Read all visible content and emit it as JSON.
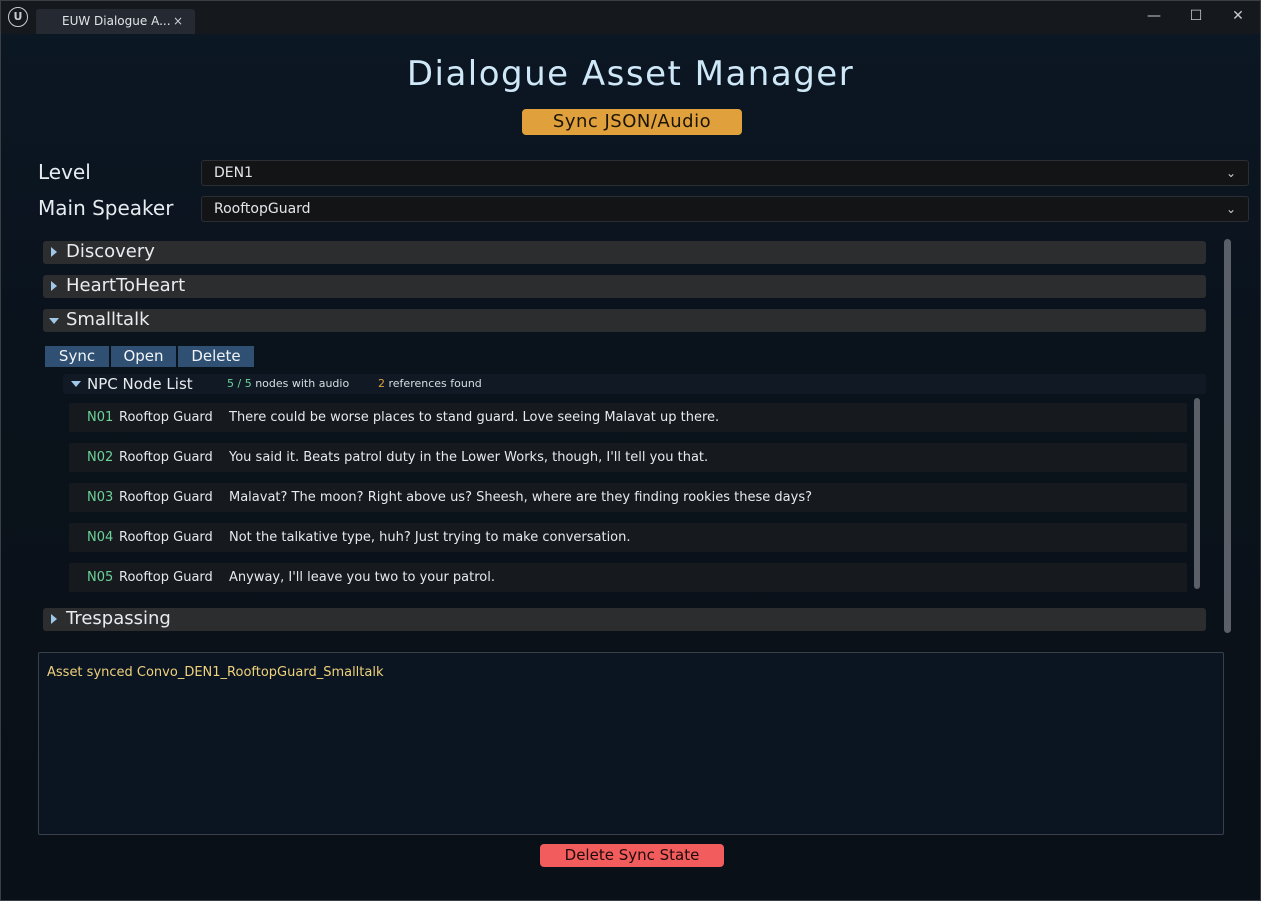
{
  "window": {
    "tab_title": "EUW Dialogue A...",
    "tab_close": "×",
    "logo": "U",
    "controls": {
      "minimize": "—",
      "maximize": "☐",
      "close": "✕"
    }
  },
  "header": {
    "title": "Dialogue Asset Manager",
    "sync_button": "Sync JSON/Audio"
  },
  "filters": {
    "level_label": "Level",
    "level_value": "DEN1",
    "speaker_label": "Main Speaker",
    "speaker_value": "RooftopGuard"
  },
  "sections": [
    {
      "label": "Discovery",
      "expanded": false
    },
    {
      "label": "HeartToHeart",
      "expanded": false
    },
    {
      "label": "Smalltalk",
      "expanded": true
    },
    {
      "label": "Trespassing",
      "expanded": false
    }
  ],
  "actions": {
    "sync": "Sync",
    "open": "Open",
    "delete": "Delete"
  },
  "npc_list": {
    "title": "NPC Node List",
    "audio_count": "5 / 5",
    "audio_suffix": "nodes with audio",
    "ref_count": "2",
    "ref_suffix": "references found",
    "nodes": [
      {
        "id": "N01",
        "speaker": "Rooftop Guard",
        "text": "There could be worse places to stand guard. Love seeing Malavat up there."
      },
      {
        "id": "N02",
        "speaker": "Rooftop Guard",
        "text": "You said it. Beats patrol duty in the Lower Works, though, I'll tell you that."
      },
      {
        "id": "N03",
        "speaker": "Rooftop Guard",
        "text": "Malavat? The moon? Right above us? Sheesh, where are they finding rookies these days?"
      },
      {
        "id": "N04",
        "speaker": "Rooftop Guard",
        "text": "Not the talkative type, huh? Just trying to make conversation."
      },
      {
        "id": "N05",
        "speaker": "Rooftop Guard",
        "text": "Anyway, I'll leave you two to your patrol."
      }
    ]
  },
  "log": {
    "message": "Asset synced Convo_DEN1_RooftopGuard_Smalltalk"
  },
  "footer": {
    "delete_sync_button": "Delete Sync State"
  },
  "icons": {
    "dropdown": "chevron-down-icon",
    "collapsed": "triangle-right-icon",
    "expanded": "triangle-down-icon"
  },
  "colors": {
    "accent_orange": "#e0a03c",
    "danger_red": "#f25c5c",
    "node_green": "#6cd39a",
    "button_blue": "#2f5072"
  }
}
